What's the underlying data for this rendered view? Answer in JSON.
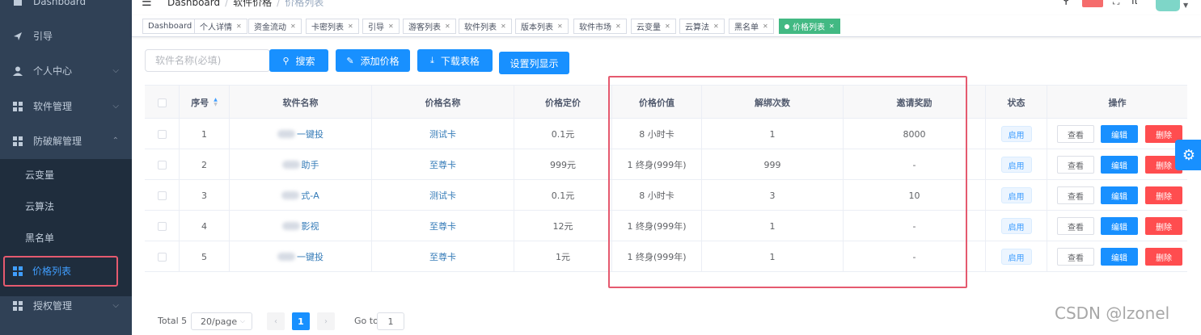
{
  "sidebar": {
    "items": [
      {
        "label": "Dashboard"
      },
      {
        "label": "引导"
      },
      {
        "label": "个人中心"
      },
      {
        "label": "软件管理"
      },
      {
        "label": "防破解管理"
      },
      {
        "label": "授权管理"
      }
    ],
    "submenu": [
      {
        "label": "云变量"
      },
      {
        "label": "云算法"
      },
      {
        "label": "黑名单"
      },
      {
        "label": "价格列表"
      }
    ]
  },
  "navbar": {
    "breadcrumb": [
      "Dashboard",
      "软件价格",
      "价格列表"
    ]
  },
  "tags": [
    {
      "label": "Dashboard"
    },
    {
      "label": "个人详情"
    },
    {
      "label": "资金流动"
    },
    {
      "label": "卡密列表"
    },
    {
      "label": "引导"
    },
    {
      "label": "游客列表"
    },
    {
      "label": "软件列表"
    },
    {
      "label": "版本列表"
    },
    {
      "label": "软件市场"
    },
    {
      "label": "云变量"
    },
    {
      "label": "云算法"
    },
    {
      "label": "黑名单"
    },
    {
      "label": "价格列表"
    }
  ],
  "toolbar": {
    "search_placeholder": "软件名称(必填)",
    "search_label": "搜索",
    "add_label": "添加价格",
    "download_label": "下载表格",
    "columns_label": "设置列显示"
  },
  "table": {
    "headers": {
      "index": "序号",
      "software": "软件名称",
      "price_name": "价格名称",
      "price": "价格定价",
      "value": "价格价值",
      "unbind": "解绑次数",
      "reward": "邀请奖励",
      "status": "状态",
      "ops": "操作"
    },
    "rows": [
      {
        "index": "1",
        "software": "一键投",
        "price_name": "测试卡",
        "price": "0.1元",
        "value": "8 小时卡",
        "unbind": "1",
        "reward": "8000",
        "status": "启用"
      },
      {
        "index": "2",
        "software": "助手",
        "price_name": "至尊卡",
        "price": "999元",
        "value": "1 终身(999年)",
        "unbind": "999",
        "reward": "-",
        "status": "启用"
      },
      {
        "index": "3",
        "software": "式-A",
        "price_name": "测试卡",
        "price": "0.1元",
        "value": "8 小时卡",
        "unbind": "3",
        "reward": "10",
        "status": "启用"
      },
      {
        "index": "4",
        "software": "影视",
        "price_name": "至尊卡",
        "price": "12元",
        "value": "1 终身(999年)",
        "unbind": "1",
        "reward": "-",
        "status": "启用"
      },
      {
        "index": "5",
        "software": "一键投",
        "price_name": "至尊卡",
        "price": "1元",
        "value": "1 终身(999年)",
        "unbind": "1",
        "reward": "-",
        "status": "启用"
      }
    ],
    "ops": {
      "view": "查看",
      "edit": "编辑",
      "delete": "删除"
    }
  },
  "pagination": {
    "total": "Total 5",
    "page_size": "20/page",
    "current_page": "1",
    "goto_label": "Go to",
    "goto_value": "1"
  },
  "watermark": "CSDN @lzonel"
}
